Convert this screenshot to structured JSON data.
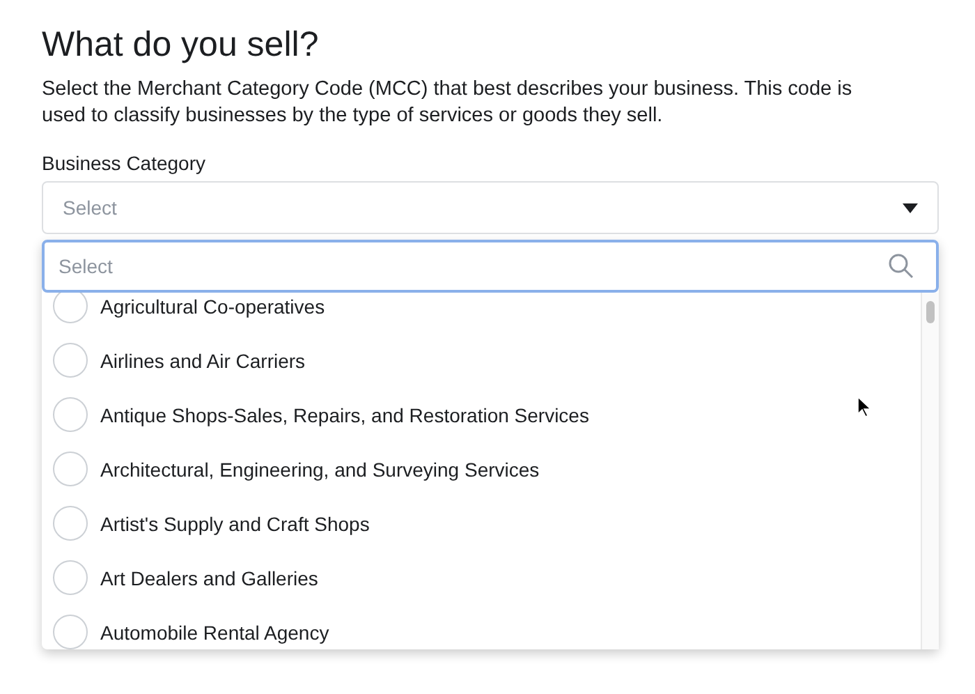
{
  "heading": "What do you sell?",
  "description": "Select the Merchant Category Code (MCC) that best describes your business. This code is used to classify businesses by the type of services or goods they sell.",
  "field_label": "Business Category",
  "select": {
    "placeholder": "Select"
  },
  "search": {
    "placeholder": "Select"
  },
  "options": [
    {
      "label": "Agricultural Co-operatives",
      "selected": false
    },
    {
      "label": "Airlines and Air Carriers",
      "selected": false
    },
    {
      "label": "Antique Shops-Sales, Repairs, and Restoration Services",
      "selected": false
    },
    {
      "label": "Architectural, Engineering, and Surveying Services",
      "selected": false
    },
    {
      "label": "Artist's Supply and Craft Shops",
      "selected": false
    },
    {
      "label": "Art Dealers and Galleries",
      "selected": false
    },
    {
      "label": "Automobile Rental Agency",
      "selected": false
    }
  ]
}
